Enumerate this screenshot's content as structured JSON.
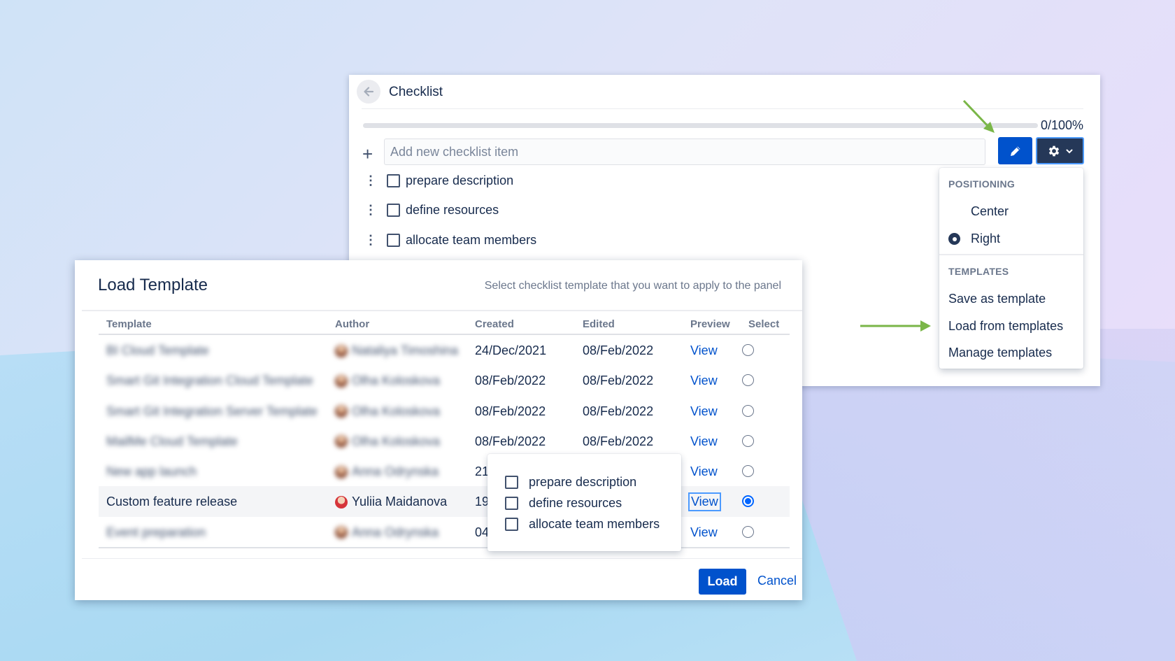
{
  "checklist": {
    "title": "Checklist",
    "progress_label": "0/100%",
    "progress_fraction": 0,
    "add_placeholder": "Add new checklist item",
    "add_icon": "plus-icon",
    "items": [
      {
        "label": "prepare description",
        "checked": false
      },
      {
        "label": "define resources",
        "checked": false
      },
      {
        "label": "allocate team members",
        "checked": false
      }
    ]
  },
  "settings_menu": {
    "positioning_heading": "POSITIONING",
    "positioning_options": [
      {
        "label": "Center",
        "selected": false
      },
      {
        "label": "Right",
        "selected": true
      }
    ],
    "templates_heading": "TEMPLATES",
    "template_actions": [
      "Save as template",
      "Load from templates",
      "Manage templates"
    ]
  },
  "load_template": {
    "title": "Load Template",
    "subtitle": "Select checklist template that you want to apply to the panel",
    "columns": [
      "Template",
      "Author",
      "Created",
      "Edited",
      "Preview",
      "Select"
    ],
    "rows": [
      {
        "template": "BI Cloud Template",
        "author": "Nataliya Timoshina",
        "created": "24/Dec/2021",
        "edited": "08/Feb/2022",
        "preview": "View",
        "selected": false,
        "blurred": true
      },
      {
        "template": "Smart Git Integration Cloud Template",
        "author": "Olha Koloskova",
        "created": "08/Feb/2022",
        "edited": "08/Feb/2022",
        "preview": "View",
        "selected": false,
        "blurred": true
      },
      {
        "template": "Smart Git Integration Server Template",
        "author": "Olha Koloskova",
        "created": "08/Feb/2022",
        "edited": "08/Feb/2022",
        "preview": "View",
        "selected": false,
        "blurred": true
      },
      {
        "template": "MailMe Cloud Template",
        "author": "Olha Koloskova",
        "created": "08/Feb/2022",
        "edited": "08/Feb/2022",
        "preview": "View",
        "selected": false,
        "blurred": true
      },
      {
        "template": "New app launch",
        "author": "Anna Odrynska",
        "created": "21",
        "edited": "",
        "preview": "View",
        "selected": false,
        "blurred": true
      },
      {
        "template": "Custom feature release",
        "author": "Yuliia Maidanova",
        "created": "19",
        "edited": "",
        "preview": "View",
        "selected": true,
        "blurred": false
      },
      {
        "template": "Event preparation",
        "author": "Anna Odrynska",
        "created": "04",
        "edited": "",
        "preview": "View",
        "selected": false,
        "blurred": true
      }
    ],
    "preview_items": [
      "prepare description",
      "define resources",
      "allocate team members"
    ],
    "load_label": "Load",
    "cancel_label": "Cancel"
  },
  "colors": {
    "primary": "#0052cc",
    "dark_button": "#253858",
    "focus": "#4c9aff",
    "annotation_arrow": "#7ab648"
  }
}
